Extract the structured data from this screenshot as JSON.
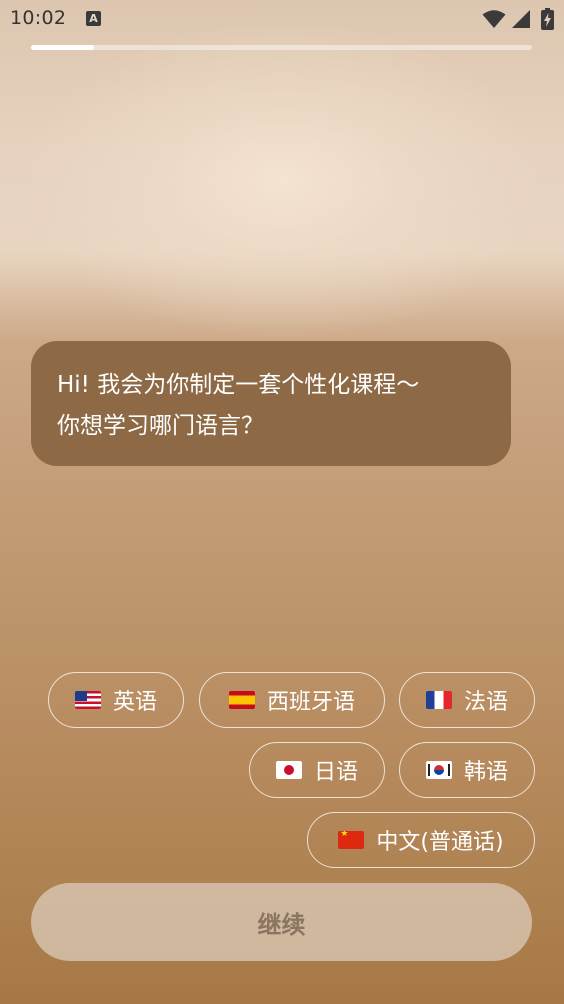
{
  "status_bar": {
    "time": "10:02",
    "notification_icon_letter": "A",
    "icons": [
      "notification-a-icon",
      "wifi-icon",
      "cellular-signal-icon",
      "battery-charging-icon"
    ]
  },
  "progress": {
    "value": 0.125
  },
  "chat": {
    "line1": "Hi! 我会为你制定一套个性化课程～",
    "line2": "你想学习哪门语言？"
  },
  "languages": [
    {
      "flag": "us-flag-icon",
      "label": "英语"
    },
    {
      "flag": "es-flag-icon",
      "label": "西班牙语"
    },
    {
      "flag": "fr-flag-icon",
      "label": "法语"
    },
    {
      "flag": "jp-flag-icon",
      "label": "日语"
    },
    {
      "flag": "kr-flag-icon",
      "label": "韩语"
    },
    {
      "flag": "cn-flag-icon",
      "label": "中文(普通话)"
    }
  ],
  "continue_label": "继续",
  "colors": {
    "bubble": "#8d6946",
    "chip_border": "#ffffff",
    "text": "#ffffff",
    "continue_text": "#8a7462"
  }
}
